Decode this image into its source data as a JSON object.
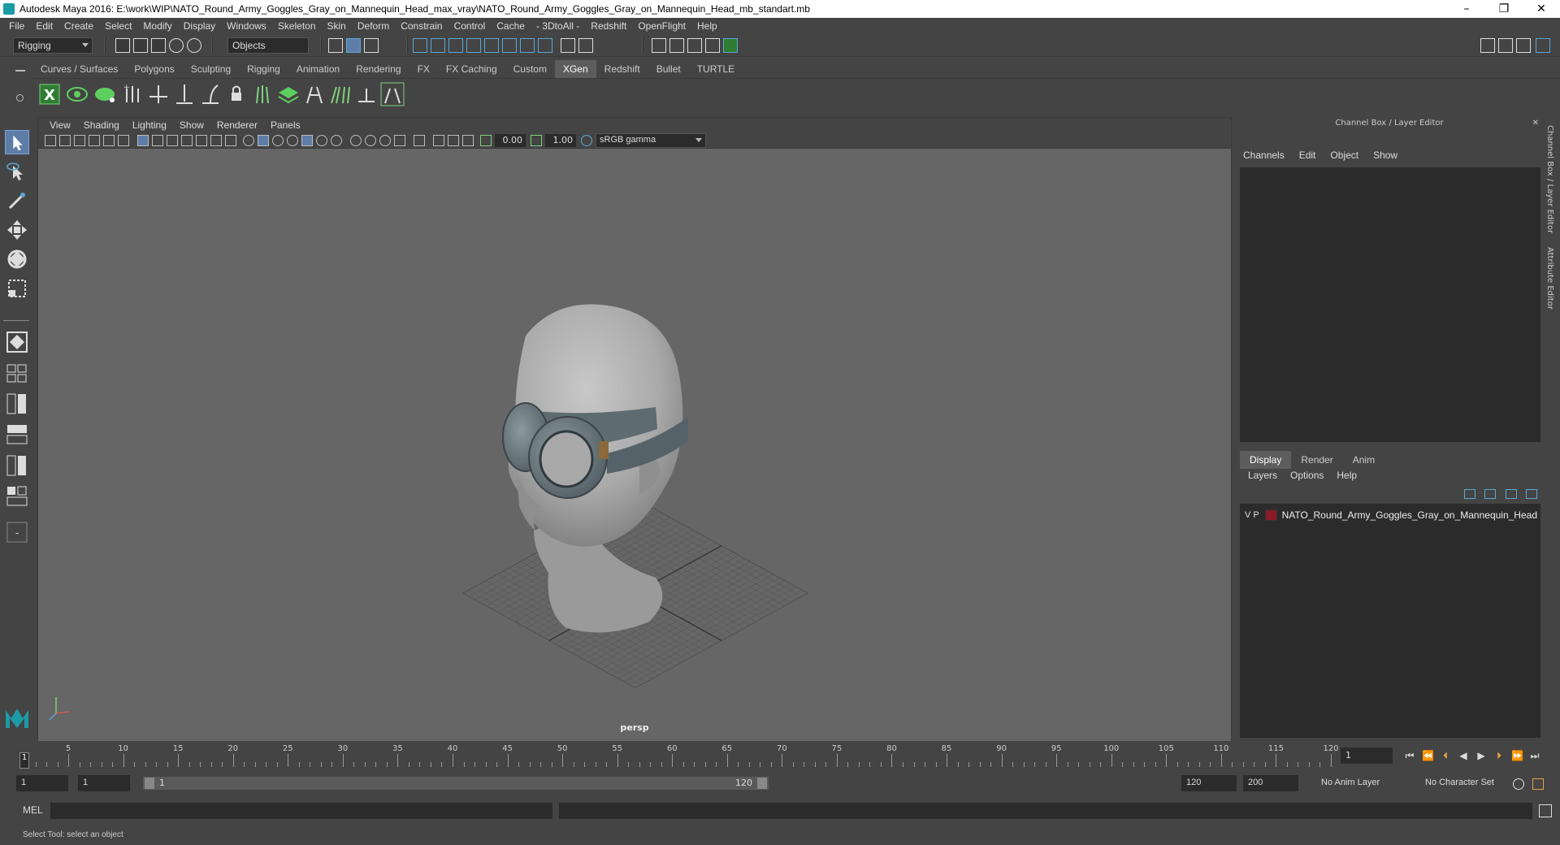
{
  "window": {
    "title": "Autodesk Maya 2016: E:\\work\\WIP\\NATO_Round_Army_Goggles_Gray_on_Mannequin_Head_max_vray\\NATO_Round_Army_Goggles_Gray_on_Mannequin_Head_mb_standart.mb",
    "minimize": "–",
    "restore": "❐",
    "close": "✕"
  },
  "menubar": [
    "File",
    "Edit",
    "Create",
    "Select",
    "Modify",
    "Display",
    "Windows",
    "Skeleton",
    "Skin",
    "Deform",
    "Constrain",
    "Control",
    "Cache",
    "- 3DtoAll -",
    "Redshift",
    "OpenFlight",
    "Help"
  ],
  "statusline": {
    "menuset": "Rigging",
    "selection_mode": "Objects"
  },
  "shelf": {
    "tabs": [
      "Curves / Surfaces",
      "Polygons",
      "Sculpting",
      "Rigging",
      "Animation",
      "Rendering",
      "FX",
      "FX Caching",
      "Custom",
      "XGen",
      "Redshift",
      "Bullet",
      "TURTLE"
    ],
    "active_tab": "XGen"
  },
  "viewport": {
    "menu": [
      "View",
      "Shading",
      "Lighting",
      "Show",
      "Renderer",
      "Panels"
    ],
    "exposure": "0.00",
    "gamma": "1.00",
    "color_space": "sRGB gamma",
    "camera_label": "persp"
  },
  "channel_box": {
    "title": "Channel Box / Layer Editor",
    "menu": [
      "Channels",
      "Edit",
      "Object",
      "Show"
    ],
    "layer_tabs": [
      "Display",
      "Render",
      "Anim"
    ],
    "active_layer_tab": "Display",
    "layer_menu": [
      "Layers",
      "Options",
      "Help"
    ],
    "layers": [
      {
        "visible": "V",
        "playback": "P",
        "name": "NATO_Round_Army_Goggles_Gray_on_Mannequin_Head",
        "color": "#8b1a2a"
      }
    ]
  },
  "side_tabs": [
    "Channel Box / Layer Editor",
    "Attribute Editor"
  ],
  "timeline": {
    "ticks": [
      "5",
      "10",
      "15",
      "20",
      "25",
      "30",
      "35",
      "40",
      "45",
      "50",
      "55",
      "60",
      "65",
      "70",
      "75",
      "80",
      "85",
      "90",
      "95",
      "100",
      "105",
      "110",
      "115",
      "120"
    ],
    "current_frame": "1",
    "current_frame_field": "1"
  },
  "range": {
    "start": "1",
    "playback_start": "1",
    "slider_start": "1",
    "slider_end": "120",
    "playback_end": "120",
    "end": "200",
    "anim_layer": "No Anim Layer",
    "character_set": "No Character Set"
  },
  "mel": {
    "label": "MEL"
  },
  "status_message": "Select Tool: select an object",
  "colors": {
    "accent": "#5aa7d6",
    "xgen_green": "#4caf50",
    "active_tool": "#5e7ea8"
  }
}
